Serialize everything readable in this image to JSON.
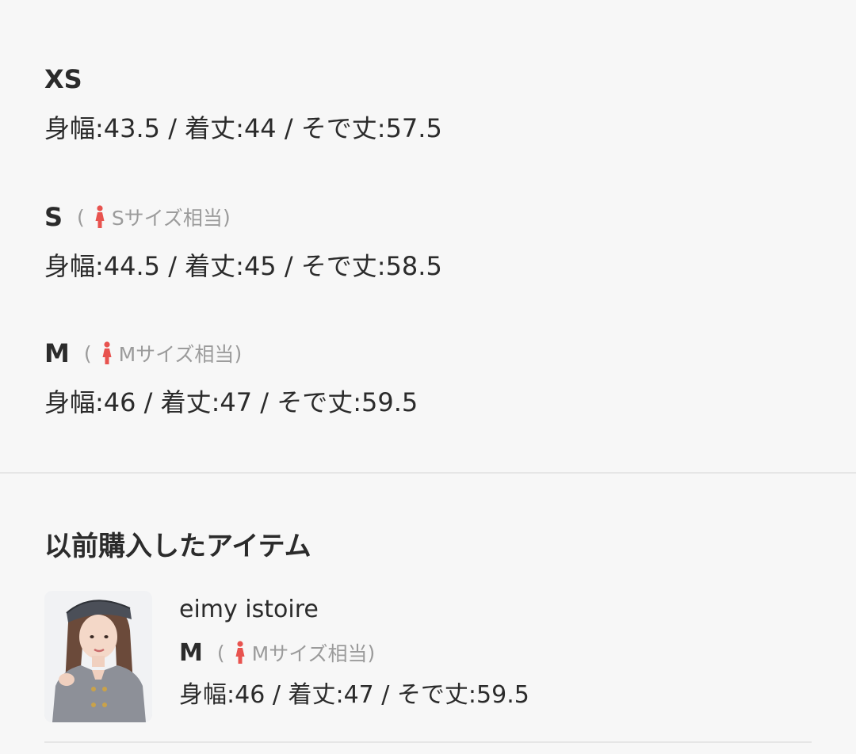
{
  "sizes": [
    {
      "name": "XS",
      "equivalent": null,
      "measurements": "身幅:43.5 / 着丈:44 / そで丈:57.5"
    },
    {
      "name": "S",
      "equivalent": {
        "open": "(",
        "label": "Sサイズ相当",
        "close": ")"
      },
      "measurements": "身幅:44.5 / 着丈:45 / そで丈:58.5"
    },
    {
      "name": "M",
      "equivalent": {
        "open": "(",
        "label": "Mサイズ相当",
        "close": ")"
      },
      "measurements": "身幅:46 / 着丈:47 / そで丈:59.5"
    }
  ],
  "previous_purchases": {
    "title": "以前購入したアイテム",
    "item": {
      "brand": "eimy istoire",
      "size": "M",
      "equivalent": {
        "open": "(",
        "label": "Mサイズ相当",
        "close": ")"
      },
      "measurements": "身幅:46 / 着丈:47 / そで丈:59.5"
    }
  },
  "colors": {
    "accent_icon": "#e8534f",
    "muted_text": "#9b9b9b",
    "text": "#2b2b2b",
    "background": "#f7f7f7",
    "divider": "#e6e6e6"
  },
  "icons": {
    "size_equivalent": "woman-figure-icon"
  }
}
